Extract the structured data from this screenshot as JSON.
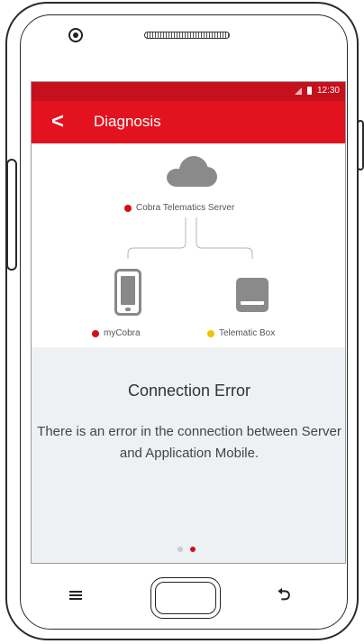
{
  "status_bar": {
    "time": "12:30"
  },
  "toolbar": {
    "title": "Diagnosis",
    "back_glyph": "<"
  },
  "diagram": {
    "server_label": "Cobra Telematics Server",
    "server_status_color": "#d0101c",
    "app_label": "myCobra",
    "app_status_color": "#d0101c",
    "box_label": "Telematic Box",
    "box_status_color": "#f2c200",
    "icons": [
      "cloud-icon",
      "smartphone-icon",
      "telematic-box-icon"
    ]
  },
  "error": {
    "title": "Connection Error",
    "message": "There is an error in the connection between Server and Application Mobile."
  },
  "pager": {
    "count": 2,
    "active_index": 1
  },
  "colors": {
    "accent": "#e3121f",
    "status_bar": "#c6101d",
    "panel_bg": "#edf1f4"
  },
  "device_nav": [
    "menu-icon",
    "home-button",
    "back-icon"
  ]
}
